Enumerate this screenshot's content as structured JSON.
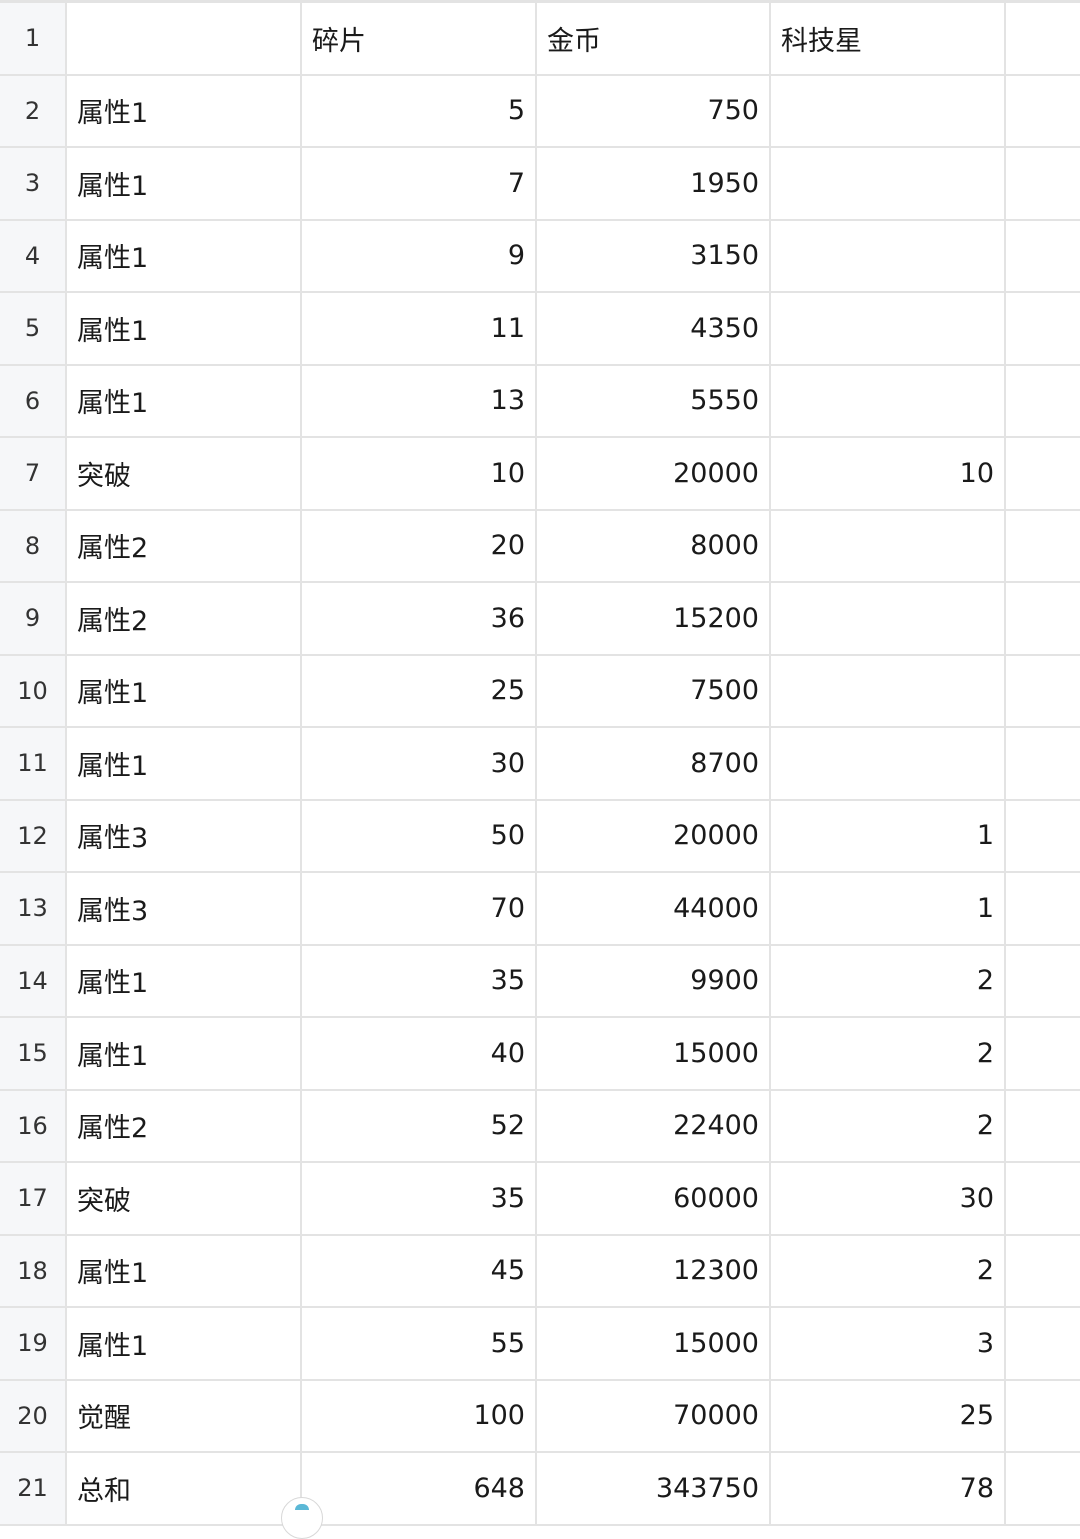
{
  "header": {
    "row_number": "1",
    "col_a": "",
    "col_b": "碎片",
    "col_c": "金币",
    "col_d": "科技星"
  },
  "rows": [
    {
      "num": "2",
      "name": "属性1",
      "shards": "5",
      "gold": "750",
      "stars": ""
    },
    {
      "num": "3",
      "name": "属性1",
      "shards": "7",
      "gold": "1950",
      "stars": ""
    },
    {
      "num": "4",
      "name": "属性1",
      "shards": "9",
      "gold": "3150",
      "stars": ""
    },
    {
      "num": "5",
      "name": "属性1",
      "shards": "11",
      "gold": "4350",
      "stars": ""
    },
    {
      "num": "6",
      "name": "属性1",
      "shards": "13",
      "gold": "5550",
      "stars": ""
    },
    {
      "num": "7",
      "name": "突破",
      "shards": "10",
      "gold": "20000",
      "stars": "10"
    },
    {
      "num": "8",
      "name": "属性2",
      "shards": "20",
      "gold": "8000",
      "stars": ""
    },
    {
      "num": "9",
      "name": "属性2",
      "shards": "36",
      "gold": "15200",
      "stars": ""
    },
    {
      "num": "10",
      "name": "属性1",
      "shards": "25",
      "gold": "7500",
      "stars": ""
    },
    {
      "num": "11",
      "name": "属性1",
      "shards": "30",
      "gold": "8700",
      "stars": ""
    },
    {
      "num": "12",
      "name": "属性3",
      "shards": "50",
      "gold": "20000",
      "stars": "1"
    },
    {
      "num": "13",
      "name": "属性3",
      "shards": "70",
      "gold": "44000",
      "stars": "1"
    },
    {
      "num": "14",
      "name": "属性1",
      "shards": "35",
      "gold": "9900",
      "stars": "2"
    },
    {
      "num": "15",
      "name": "属性1",
      "shards": "40",
      "gold": "15000",
      "stars": "2"
    },
    {
      "num": "16",
      "name": "属性2",
      "shards": "52",
      "gold": "22400",
      "stars": "2"
    },
    {
      "num": "17",
      "name": "突破",
      "shards": "35",
      "gold": "60000",
      "stars": "30"
    },
    {
      "num": "18",
      "name": "属性1",
      "shards": "45",
      "gold": "12300",
      "stars": "2"
    },
    {
      "num": "19",
      "name": "属性1",
      "shards": "55",
      "gold": "15000",
      "stars": "3"
    },
    {
      "num": "20",
      "name": "觉醒",
      "shards": "100",
      "gold": "70000",
      "stars": "25"
    },
    {
      "num": "21",
      "name": "总和",
      "shards": "648",
      "gold": "343750",
      "stars": "78"
    }
  ]
}
